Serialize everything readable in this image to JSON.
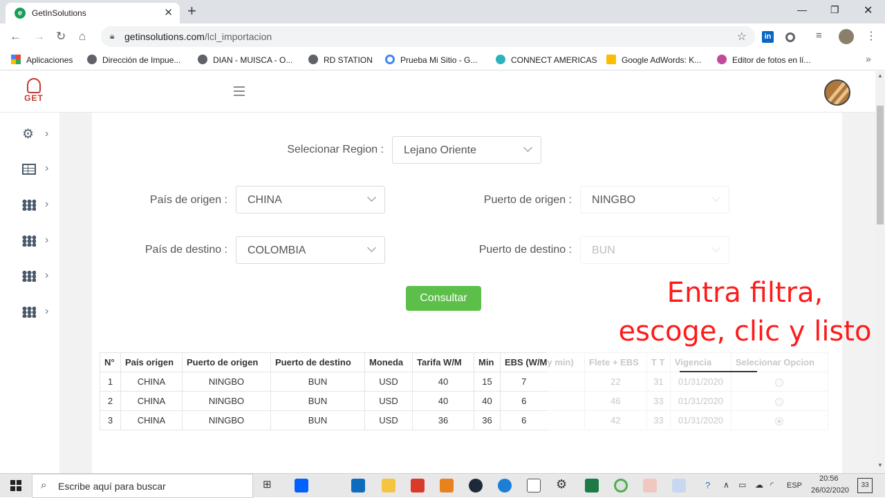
{
  "browser": {
    "tab_title": "GetInSolutions",
    "url_host": "getinsolutions.com",
    "url_path": "/lcl_importacion",
    "bookmarks": [
      {
        "label": "Aplicaciones",
        "icon": "apps-grid-icon"
      },
      {
        "label": "Dirección de Impue...",
        "icon": "globe-icon"
      },
      {
        "label": "DIAN - MUISCA - O...",
        "icon": "globe-icon"
      },
      {
        "label": "RD STATION",
        "icon": "globe-icon"
      },
      {
        "label": "Prueba Mi Sitio - G...",
        "icon": "google-icon"
      },
      {
        "label": "CONNECT AMERICAS",
        "icon": "star-icon"
      },
      {
        "label": "Google AdWords: K...",
        "icon": "adwords-icon"
      },
      {
        "label": "Editor de fotos en lí...",
        "icon": "photo-editor-icon"
      }
    ]
  },
  "app": {
    "logo_text": "GET"
  },
  "form": {
    "region_label": "Selecionar Region :",
    "region_value": "Lejano Oriente",
    "origin_country_label": "País de origen :",
    "origin_country_value": "CHINA",
    "origin_port_label": "Puerto de origen :",
    "origin_port_value": "NINGBO",
    "dest_country_label": "País de destino :",
    "dest_country_value": "COLOMBIA",
    "dest_port_label": "Puerto de destino :",
    "dest_port_value": "BUN",
    "submit_label": "Consultar"
  },
  "annotation": {
    "line1": "Entra filtra,",
    "line2": "escoge, clic y listo"
  },
  "table": {
    "headers": [
      "N°",
      "País origen",
      "Puerto de origen",
      "Puerto de destino",
      "Moneda",
      "Tarifa W/M",
      "Min",
      "EBS (W/M",
      "y min)",
      "Flete + EBS",
      "T T",
      "Vigencia",
      "Selecionar Opcion"
    ],
    "rows": [
      [
        "1",
        "CHINA",
        "NINGBO",
        "BUN",
        "USD",
        "40",
        "15",
        "7",
        "22",
        "31",
        "01/31/2020"
      ],
      [
        "2",
        "CHINA",
        "NINGBO",
        "BUN",
        "USD",
        "40",
        "40",
        "6",
        "46",
        "33",
        "01/31/2020"
      ],
      [
        "3",
        "CHINA",
        "NINGBO",
        "BUN",
        "USD",
        "36",
        "36",
        "6",
        "42",
        "33",
        "01/31/2020"
      ]
    ],
    "selected_row": 3
  },
  "taskbar": {
    "search_placeholder": "Escribe aquí para buscar",
    "language": "ESP",
    "time": "20:56",
    "date": "26/02/2020",
    "notifications": "33"
  },
  "colors": {
    "accent_green": "#5cbf4a",
    "annotation_red": "#ff1a1a",
    "brand_red": "#c43a2f"
  }
}
